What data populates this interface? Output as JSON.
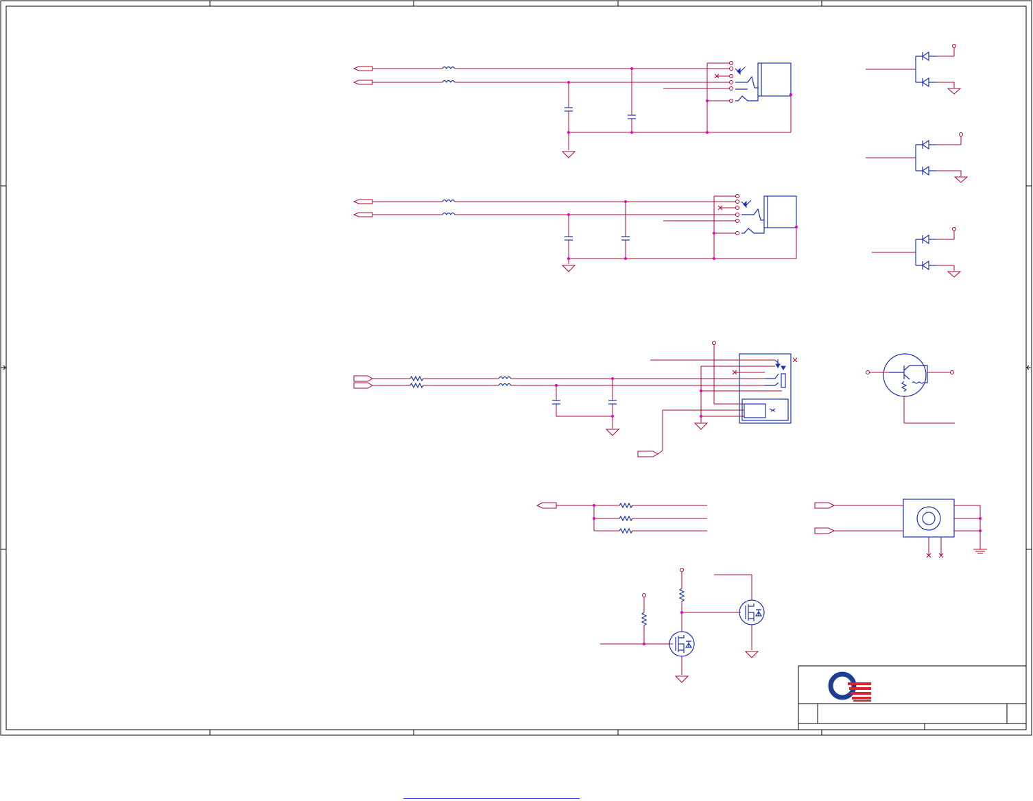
{
  "colors": {
    "wire": "#b0002a",
    "component": "#1a2fb3",
    "frame": "#000000",
    "junction": "#e400c8",
    "logo_blue": "#1c3f94",
    "logo_red": "#d7262f"
  },
  "icons": [
    "company-logo"
  ],
  "footer": {
    "link_text": ""
  }
}
